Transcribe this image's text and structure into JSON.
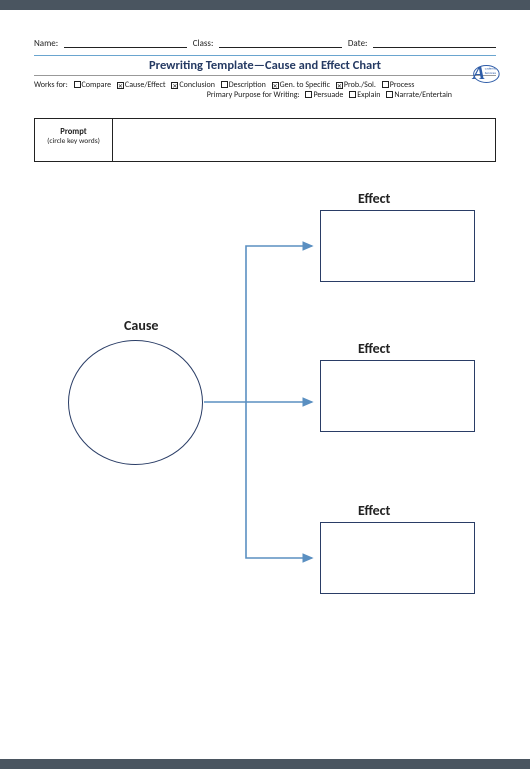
{
  "header": {
    "name_label": "Name:",
    "class_label": "Class:",
    "date_label": "Date:"
  },
  "title": "Prewriting Template—Cause and Effect Chart",
  "works_for": {
    "lead": "Works for:",
    "items": [
      {
        "label": "Compare",
        "checked": false
      },
      {
        "label": "Cause/Effect",
        "checked": true
      },
      {
        "label": "Conclusion",
        "checked": true
      },
      {
        "label": "Description",
        "checked": false
      },
      {
        "label": "Gen. to Specific",
        "checked": true
      },
      {
        "label": "Prob./Sol.",
        "checked": true
      },
      {
        "label": "Process",
        "checked": false
      }
    ]
  },
  "purpose": {
    "lead": "Primary Purpose for Writing:",
    "items": [
      {
        "label": "Persuade",
        "checked": false
      },
      {
        "label": "Explain",
        "checked": false
      },
      {
        "label": "Narrate/Entertain",
        "checked": false
      }
    ]
  },
  "prompt": {
    "title": "Prompt",
    "subtitle": "(circle key words)"
  },
  "diagram": {
    "cause_label": "Cause",
    "effect1_label": "Effect",
    "effect2_label": "Effect",
    "effect3_label": "Effect"
  },
  "colors": {
    "accent_blue": "#6aa5cf",
    "box_navy": "#2a3d66",
    "arrow_blue": "#5a8fc1"
  }
}
